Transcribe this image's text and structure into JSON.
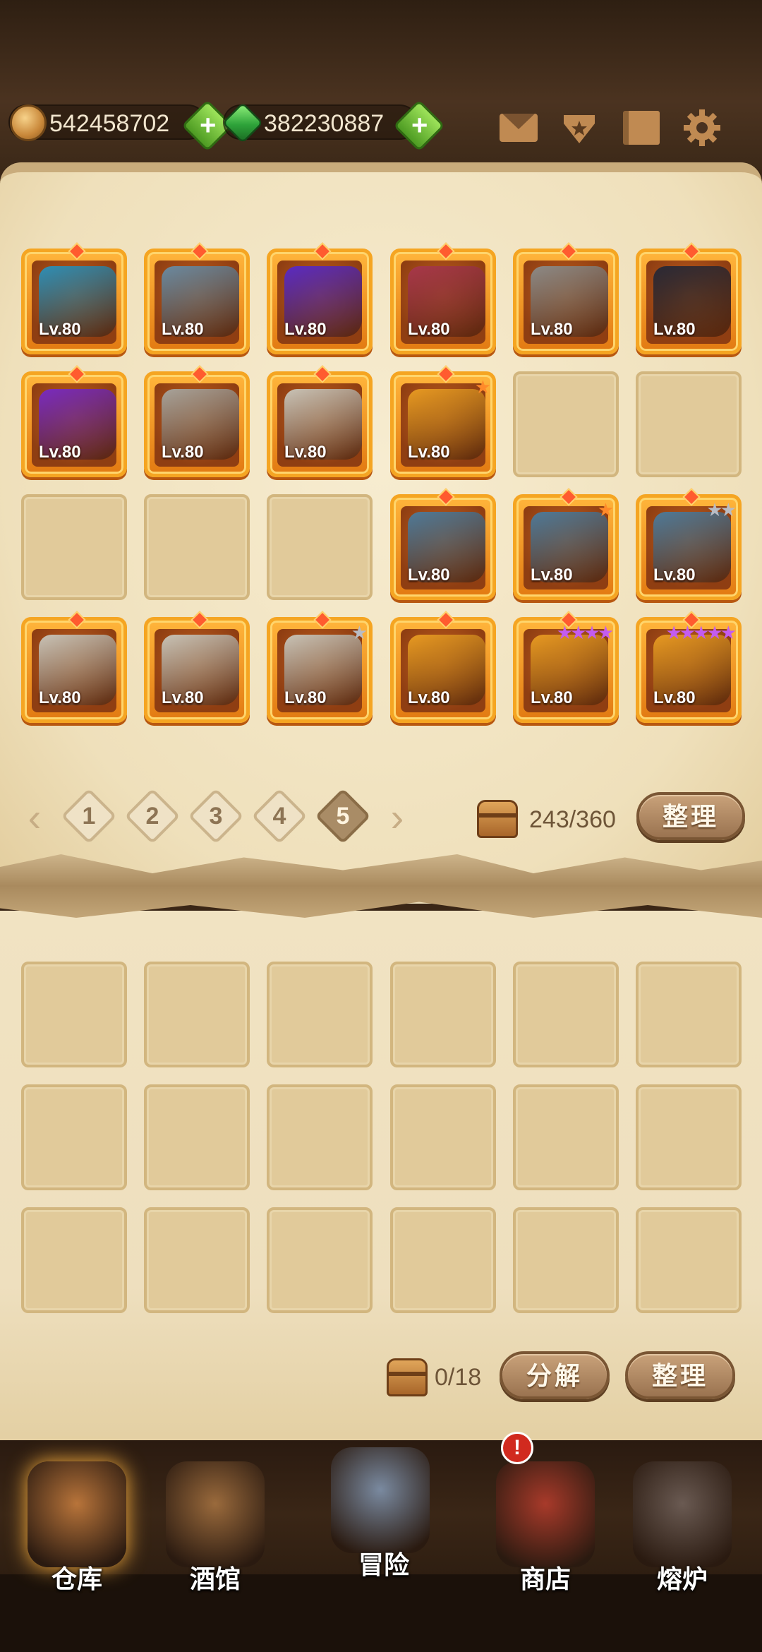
{
  "currencies": {
    "gold": {
      "value": "542458702"
    },
    "gems": {
      "value": "382230887"
    }
  },
  "top_icons": [
    "mail-icon",
    "favorite-icon",
    "book-icon",
    "gear-icon"
  ],
  "inventory": {
    "rows": [
      [
        {
          "level": "Lv.80",
          "color": "#2f8fb5"
        },
        {
          "level": "Lv.80",
          "color": "#6b8aa0"
        },
        {
          "level": "Lv.80",
          "color": "#5b2bc2"
        },
        {
          "level": "Lv.80",
          "color": "#a8384a"
        },
        {
          "level": "Lv.80",
          "color": "#8d8a86"
        },
        {
          "level": "Lv.80",
          "color": "#2b2a36"
        }
      ],
      [
        {
          "level": "Lv.80",
          "color": "#7a2bbf"
        },
        {
          "level": "Lv.80",
          "color": "#a8a39a"
        },
        {
          "level": "Lv.80",
          "color": "#c9c3b6"
        },
        {
          "level": "Lv.80",
          "color": "#e89a22",
          "stars": "★",
          "star_color": "#ff8a2a"
        },
        null,
        null
      ],
      [
        null,
        null,
        null,
        {
          "level": "Lv.80",
          "color": "#4f7a98"
        },
        {
          "level": "Lv.80",
          "color": "#4f7a98",
          "stars": "★",
          "star_color": "#ff8a2a"
        },
        {
          "level": "Lv.80",
          "color": "#4f7a98",
          "stars": "★★",
          "star_color": "#b9bcc4"
        }
      ],
      [
        {
          "level": "Lv.80",
          "color": "#c9c3b6"
        },
        {
          "level": "Lv.80",
          "color": "#c9c3b6"
        },
        {
          "level": "Lv.80",
          "color": "#c9c3b6",
          "stars": "★",
          "star_color": "#b9bcc4"
        },
        {
          "level": "Lv.80",
          "color": "#e89a22"
        },
        {
          "level": "Lv.80",
          "color": "#e89a22",
          "stars": "★★★★",
          "star_color": "#c35cf0"
        },
        {
          "level": "Lv.80",
          "color": "#e89a22",
          "stars": "★★★★★",
          "star_color": "#c35cf0"
        }
      ]
    ]
  },
  "pager": {
    "pages": [
      "1",
      "2",
      "3",
      "4",
      "5"
    ],
    "active": "5"
  },
  "capacity": {
    "text": "243/360"
  },
  "sort_button": "整理",
  "salvage": {
    "count": "0/18",
    "decompose_button": "分解",
    "sort_button": "整理"
  },
  "nav": [
    {
      "label": "仓库",
      "color": "#b8743a"
    },
    {
      "label": "酒馆",
      "color": "#9a6a3c"
    },
    {
      "label": "冒险",
      "color": "#7a8aa0"
    },
    {
      "label": "商店",
      "color": "#a83a2a"
    },
    {
      "label": "熔炉",
      "color": "#6a5a52"
    }
  ],
  "shop_alert": "!"
}
